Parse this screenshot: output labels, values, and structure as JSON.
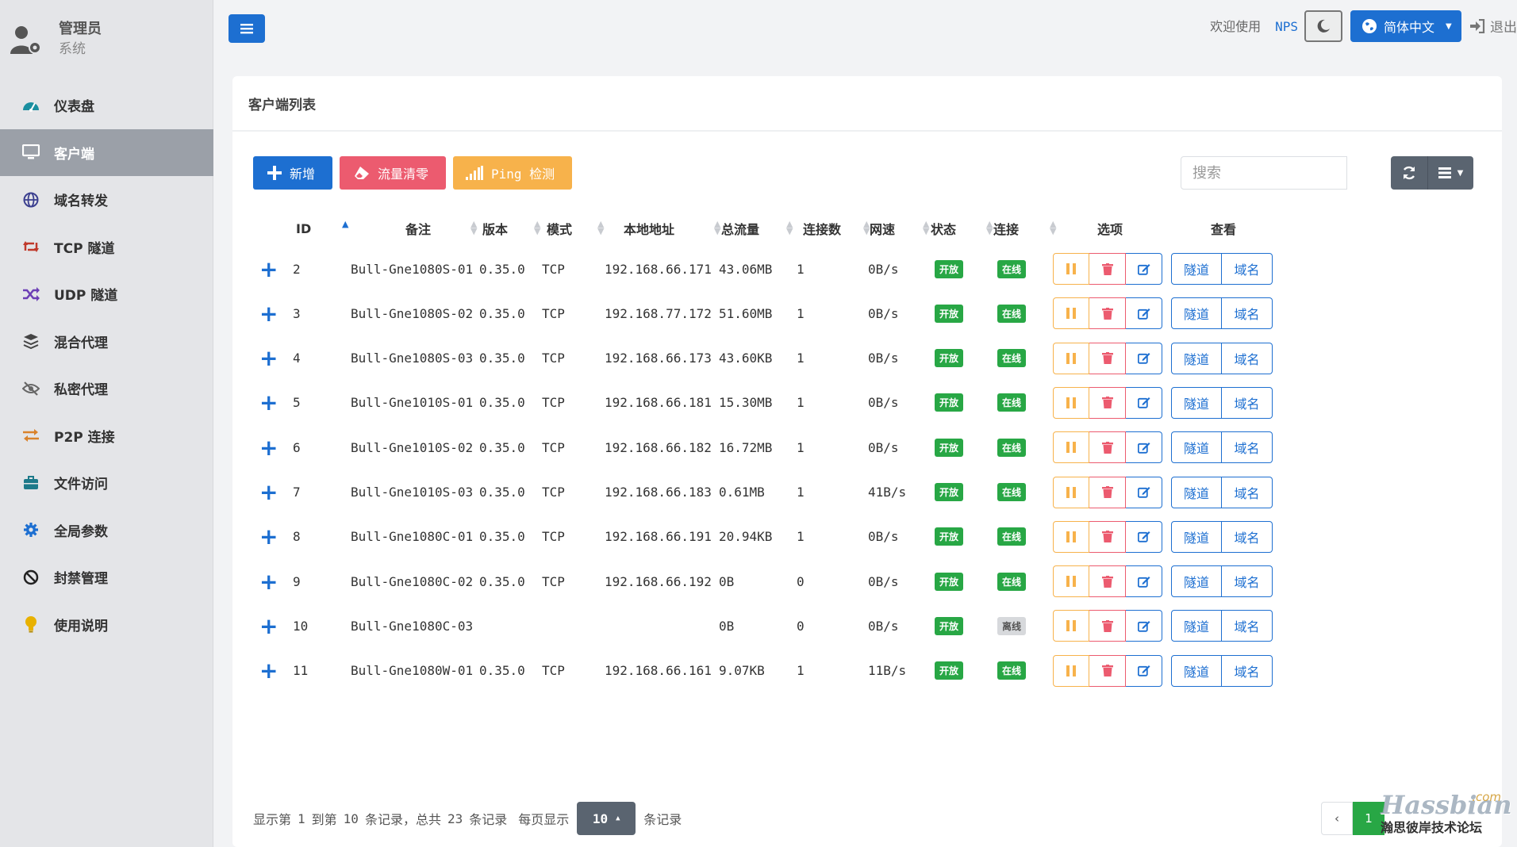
{
  "user": {
    "name": "管理员",
    "role": "系统"
  },
  "sidebar": {
    "items": [
      {
        "label": "仪表盘",
        "icon": "dashboard-icon"
      },
      {
        "label": "客户端",
        "icon": "monitor-icon",
        "active": true
      },
      {
        "label": "域名转发",
        "icon": "globe-icon"
      },
      {
        "label": "TCP 隧道",
        "icon": "retweet-icon"
      },
      {
        "label": "UDP 隧道",
        "icon": "shuffle-icon"
      },
      {
        "label": "混合代理",
        "icon": "layers-icon"
      },
      {
        "label": "私密代理",
        "icon": "eye-slash-icon"
      },
      {
        "label": "P2P 连接",
        "icon": "exchange-icon"
      },
      {
        "label": "文件访问",
        "icon": "briefcase-icon"
      },
      {
        "label": "全局参数",
        "icon": "gear-icon"
      },
      {
        "label": "封禁管理",
        "icon": "ban-icon"
      },
      {
        "label": "使用说明",
        "icon": "lightbulb-icon"
      }
    ]
  },
  "header": {
    "welcome": "欢迎使用",
    "brand": "NPS",
    "language": "简体中文",
    "logout": "退出"
  },
  "panel": {
    "title": "客户端列表",
    "toolbar": {
      "add": "新增",
      "clear": "流量清零",
      "ping": "Ping 检测"
    },
    "search_placeholder": "搜索"
  },
  "table": {
    "columns": [
      "ID",
      "备注",
      "版本",
      "模式",
      "本地地址",
      "总流量",
      "连接数",
      "网速",
      "状态",
      "连接",
      "选项",
      "查看"
    ],
    "rows": [
      {
        "id": "2",
        "remark": "Bull-Gne1080S-01",
        "version": "0.35.0",
        "mode": "TCP",
        "addr": "192.168.66.171",
        "flow": "43.06MB",
        "conn": "1",
        "rate": "0B/s",
        "status": "开放",
        "online": "在线"
      },
      {
        "id": "3",
        "remark": "Bull-Gne1080S-02",
        "version": "0.35.0",
        "mode": "TCP",
        "addr": "192.168.77.172",
        "flow": "51.60MB",
        "conn": "1",
        "rate": "0B/s",
        "status": "开放",
        "online": "在线"
      },
      {
        "id": "4",
        "remark": "Bull-Gne1080S-03",
        "version": "0.35.0",
        "mode": "TCP",
        "addr": "192.168.66.173",
        "flow": "43.60KB",
        "conn": "1",
        "rate": "0B/s",
        "status": "开放",
        "online": "在线"
      },
      {
        "id": "5",
        "remark": "Bull-Gne1010S-01",
        "version": "0.35.0",
        "mode": "TCP",
        "addr": "192.168.66.181",
        "flow": "15.30MB",
        "conn": "1",
        "rate": "0B/s",
        "status": "开放",
        "online": "在线"
      },
      {
        "id": "6",
        "remark": "Bull-Gne1010S-02",
        "version": "0.35.0",
        "mode": "TCP",
        "addr": "192.168.66.182",
        "flow": "16.72MB",
        "conn": "1",
        "rate": "0B/s",
        "status": "开放",
        "online": "在线"
      },
      {
        "id": "7",
        "remark": "Bull-Gne1010S-03",
        "version": "0.35.0",
        "mode": "TCP",
        "addr": "192.168.66.183",
        "flow": "0.61MB",
        "conn": "1",
        "rate": "41B/s",
        "status": "开放",
        "online": "在线"
      },
      {
        "id": "8",
        "remark": "Bull-Gne1080C-01",
        "version": "0.35.0",
        "mode": "TCP",
        "addr": "192.168.66.191",
        "flow": "20.94KB",
        "conn": "1",
        "rate": "0B/s",
        "status": "开放",
        "online": "在线"
      },
      {
        "id": "9",
        "remark": "Bull-Gne1080C-02",
        "version": "0.35.0",
        "mode": "TCP",
        "addr": "192.168.66.192",
        "flow": "0B",
        "conn": "0",
        "rate": "0B/s",
        "status": "开放",
        "online": "在线"
      },
      {
        "id": "10",
        "remark": "Bull-Gne1080C-03",
        "version": "",
        "mode": "",
        "addr": "",
        "flow": "0B",
        "conn": "0",
        "rate": "0B/s",
        "status": "开放",
        "online": "离线"
      },
      {
        "id": "11",
        "remark": "Bull-Gne1080W-01",
        "version": "0.35.0",
        "mode": "TCP",
        "addr": "192.168.66.161",
        "flow": "9.07KB",
        "conn": "1",
        "rate": "11B/s",
        "status": "开放",
        "online": "在线"
      }
    ],
    "view_labels": {
      "tunnel": "隧道",
      "domain": "域名"
    }
  },
  "pager": {
    "show_from_label": "显示第",
    "from": "1",
    "to_label": "到第",
    "to": "10",
    "records_label": "条记录，总共",
    "total": "23",
    "records_label2": "条记录",
    "per_page_label": "每页显示",
    "page_size": "10",
    "records_label3": "条记录",
    "prev": "‹",
    "current_page": "1"
  },
  "watermark": {
    "logo": "Hassbian",
    "com": ".com",
    "sub": "瀚思彼岸技术论坛"
  },
  "colors": {
    "primary": "#1d6fd1",
    "danger": "#ec5b6f",
    "warning": "#f7b24b",
    "success": "#28a745",
    "sidebar_active": "#9ba0a8"
  }
}
